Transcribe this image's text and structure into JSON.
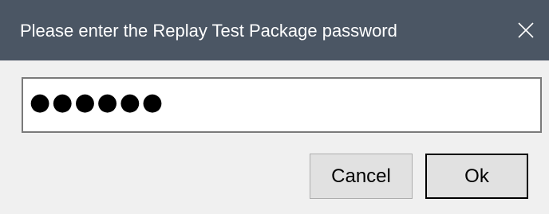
{
  "dialog": {
    "title": "Please enter the Replay Test Package password",
    "close_icon": "close-icon"
  },
  "password_field": {
    "value": "●●●●●●"
  },
  "buttons": {
    "cancel_label": "Cancel",
    "ok_label": "Ok"
  },
  "colors": {
    "titlebar_bg": "#4b5664",
    "dialog_bg": "#f0f0f0",
    "button_bg": "#e1e1e1",
    "default_button_border": "#000000"
  }
}
